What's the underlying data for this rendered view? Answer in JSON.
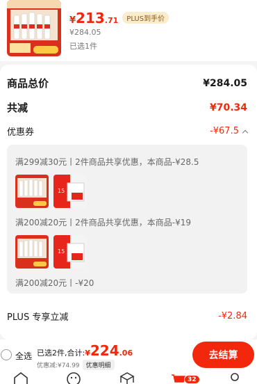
{
  "product": {
    "price_symbol": "¥",
    "price_int": "213",
    "price_dec": ".71",
    "plus_tag": "PLUS到手价",
    "orig_price": "¥284.05",
    "selected_count": "已选1件",
    "image_alt": "商品图片-白酒礼盒"
  },
  "summary": {
    "total_label": "商品总价",
    "total_value": "¥284.05",
    "discount_label": "共减",
    "discount_value": "¥70.34",
    "coupon_label": "优惠券",
    "coupon_value": "-¥67.5"
  },
  "coupons": [
    {
      "text": "满299减30元丨2件商品共享优惠，本商品-¥28.5"
    },
    {
      "text": "满200减20元丨2件商品共享优惠，本商品-¥19"
    },
    {
      "text": "满200减20元丨-¥20"
    }
  ],
  "plus_discount": {
    "label": "PLUS 专享立减",
    "value": "-¥2.84"
  },
  "bottom": {
    "select_all": "全选",
    "selected_total_label": "已选2件,合计:",
    "total_symbol": "¥",
    "total_int": "224",
    "total_dec": ".06",
    "saved_text": "优惠减:¥74.99",
    "detail_button": "优惠明细",
    "checkout_button": "去结算"
  },
  "tabbar": {
    "cart_badge": "32",
    "tabs": [
      "home-icon",
      "smile-icon",
      "box-icon",
      "cart-icon",
      "user-icon"
    ]
  },
  "colors": {
    "accent": "#f2270c",
    "plus_tag_bg": "#fbeccc",
    "plus_tag_text": "#8a5a1a"
  }
}
